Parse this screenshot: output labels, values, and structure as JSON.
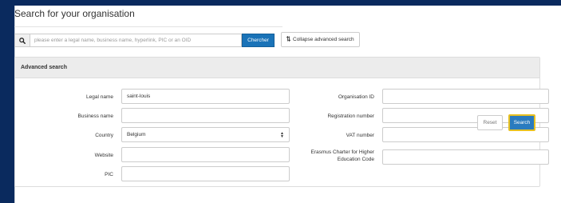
{
  "title": "Search for your organisation",
  "search": {
    "placeholder": "please enter a legal name, business name, hyperlink, PIC or an OID",
    "value": "",
    "submit_label": "Chercher",
    "search_icon": "search-icon"
  },
  "collapse": {
    "icon": "sort-arrows-icon",
    "label": "Collapse advanced search"
  },
  "advanced": {
    "heading": "Advanced search",
    "legal_name": {
      "label": "Legal name",
      "value": "saint-louis"
    },
    "business_name": {
      "label": "Business name",
      "value": ""
    },
    "country": {
      "label": "Country",
      "value": "Belgium"
    },
    "website": {
      "label": "Website",
      "value": ""
    },
    "pic": {
      "label": "PIC",
      "value": ""
    },
    "organisation_id": {
      "label": "Organisation ID",
      "value": ""
    },
    "registration_number": {
      "label": "Registration number",
      "value": ""
    },
    "vat_number": {
      "label": "VAT number",
      "value": ""
    },
    "erasmus_code": {
      "label_line1": "Erasmus Charter for Higher",
      "label_line2": "Education Code",
      "value": ""
    },
    "reset_label": "Reset",
    "search_label": "Search"
  },
  "colors": {
    "outer_background": "#0a2a5e",
    "primary_button": "#1a73b8",
    "focus_ring": "#e8c020"
  }
}
